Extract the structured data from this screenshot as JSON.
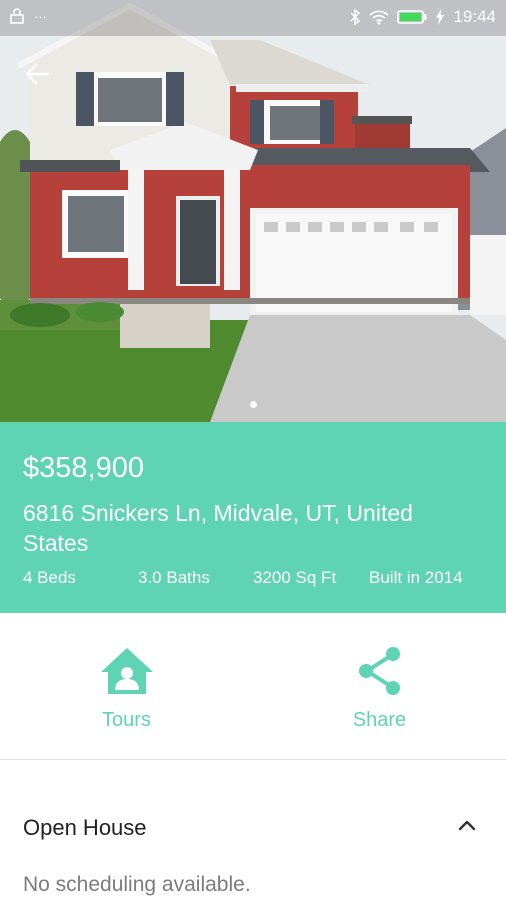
{
  "status_bar": {
    "time": "19:44",
    "dots": "···"
  },
  "listing": {
    "price": "$358,900",
    "address": "6816 Snickers Ln, Midvale, UT, United States",
    "beds": "4 Beds",
    "baths": "3.0 Baths",
    "sqft": "3200 Sq Ft",
    "built": "Built in 2014"
  },
  "actions": {
    "tours_label": "Tours",
    "share_label": "Share"
  },
  "open_house": {
    "title": "Open House",
    "note": "No scheduling available."
  },
  "colors": {
    "accent": "#5fd4b4"
  },
  "icons": [
    "lock-icon",
    "bluetooth-icon",
    "wifi-icon",
    "battery-icon",
    "back-arrow-icon",
    "house-icon",
    "share-icon",
    "chevron-up-icon"
  ]
}
